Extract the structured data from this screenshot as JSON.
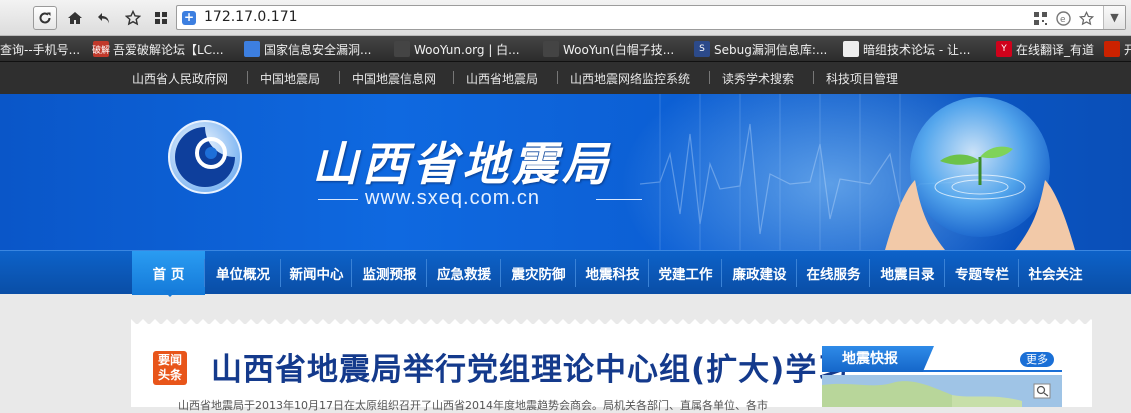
{
  "browser": {
    "url": "172.17.0.171"
  },
  "bookmarks": [
    {
      "label": "查询--手机号...",
      "color": "#cccccc"
    },
    {
      "label": "吾爱破解论坛【LC...",
      "color": "#c0392b",
      "fav_text": "破解"
    },
    {
      "label": "国家信息安全漏洞...",
      "color": "#3d7fe0"
    },
    {
      "label": "WooYun.org | 白...",
      "color": "#444444"
    },
    {
      "label": "WooYun(白帽子技...",
      "color": "#444444"
    },
    {
      "label": "Sebug漏洞信息库:...",
      "color": "#2c4a8a",
      "fav_text": "S"
    },
    {
      "label": "暗组技术论坛 - 让...",
      "color": "#eeeeee"
    },
    {
      "label": "在线翻译_有道",
      "color": "#d0021b",
      "fav_text": "Y"
    },
    {
      "label": "开",
      "color": "#cc2200"
    }
  ],
  "top_links": [
    "山西省人民政府网",
    "中国地震局",
    "中国地震信息网",
    "山西省地震局",
    "山西地震网络监控系统",
    "读秀学术搜索",
    "科技项目管理"
  ],
  "banner": {
    "title": "山西省地震局",
    "url": "www.sxeq.com.cn"
  },
  "nav": [
    "首 页",
    "单位概况",
    "新闻中心",
    "监测预报",
    "应急救援",
    "震灾防御",
    "地震科技",
    "党建工作",
    "廉政建设",
    "在线服务",
    "地震目录",
    "专题专栏",
    "社会关注"
  ],
  "main": {
    "badge_line1": "要闻",
    "badge_line2": "头条",
    "headline": "山西省地震局举行党组理论中心组(扩大)学习",
    "snippet": "山西省地震局于2013年10月17日在太原组织召开了山西省2014年度地震趋势会商会。局机关各部门、直属各单位、各市"
  },
  "sidebar": {
    "title": "地震快报",
    "more": "更多"
  },
  "colors": {
    "banner_blue": "#0f69e0",
    "nav_blue": "#0a4ea6",
    "headline": "#143a8c",
    "badge": "#e8551a"
  }
}
